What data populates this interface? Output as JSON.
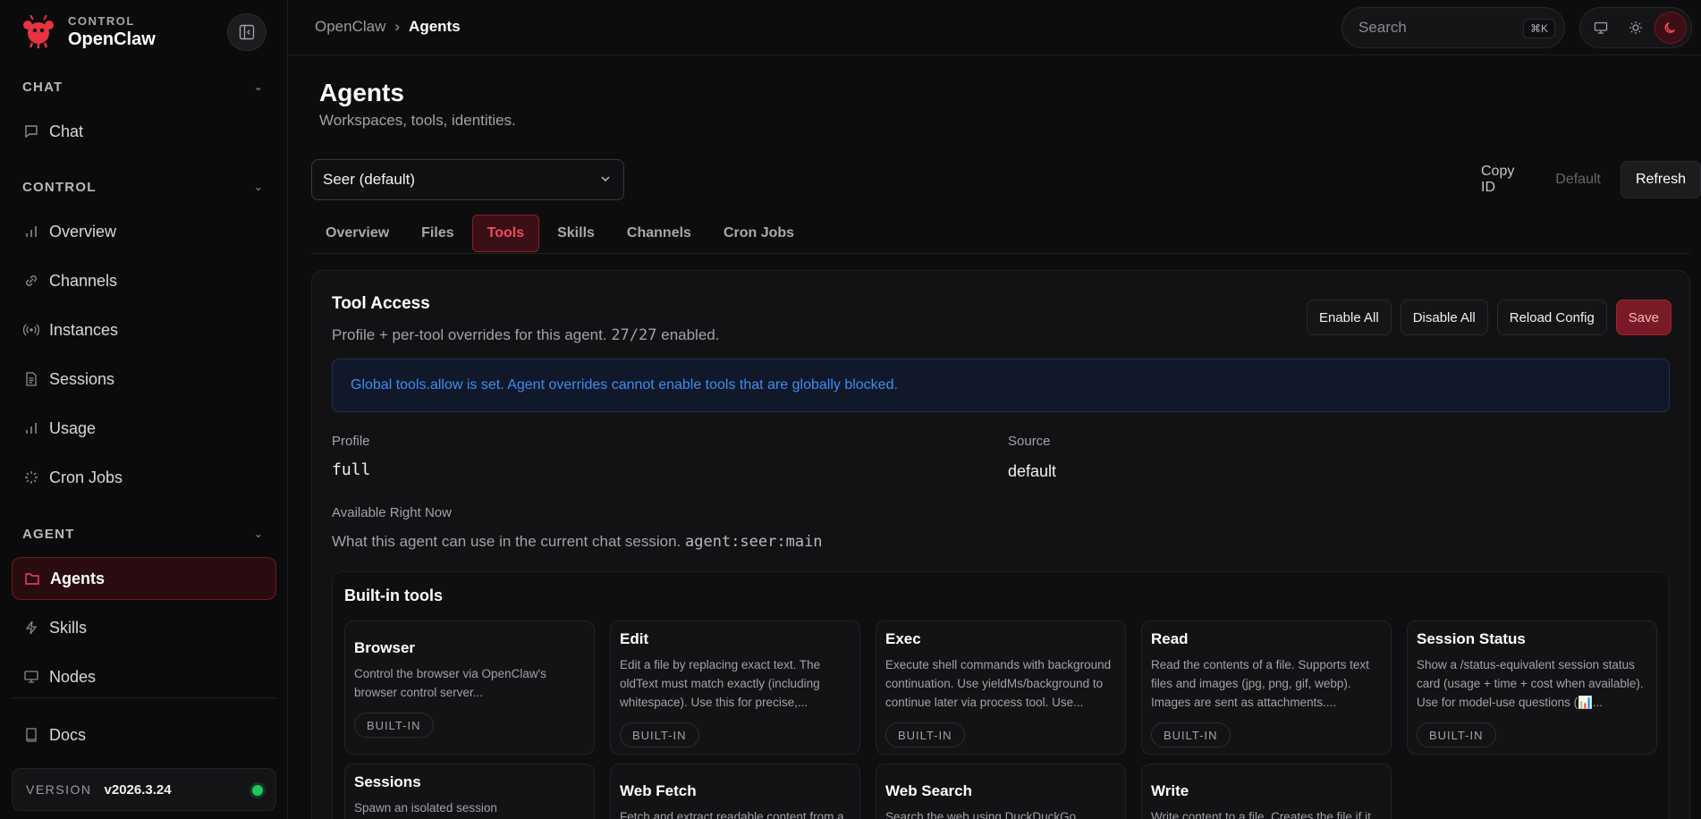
{
  "brand": {
    "eyebrow": "CONTROL",
    "name": "OpenClaw",
    "logo_icon": "lobster-logo-icon"
  },
  "sidebar": {
    "sections": [
      {
        "label": "CHAT",
        "items": [
          {
            "label": "Chat",
            "icon": "chat-bubble-icon"
          }
        ]
      },
      {
        "label": "CONTROL",
        "items": [
          {
            "label": "Overview",
            "icon": "bar-chart-icon"
          },
          {
            "label": "Channels",
            "icon": "link-icon"
          },
          {
            "label": "Instances",
            "icon": "broadcast-icon"
          },
          {
            "label": "Sessions",
            "icon": "document-icon"
          },
          {
            "label": "Usage",
            "icon": "bar-chart-icon"
          },
          {
            "label": "Cron Jobs",
            "icon": "loader-icon"
          }
        ]
      },
      {
        "label": "AGENT",
        "items": [
          {
            "label": "Agents",
            "icon": "folder-icon",
            "active": true
          },
          {
            "label": "Skills",
            "icon": "lightning-icon"
          },
          {
            "label": "Nodes",
            "icon": "monitor-icon"
          }
        ]
      }
    ],
    "docs": {
      "label": "Docs",
      "icon": "book-icon"
    },
    "version": {
      "label": "VERSION",
      "value": "v2026.3.24",
      "status_color": "#22c55e"
    }
  },
  "topbar": {
    "breadcrumb": {
      "root": "OpenClaw",
      "separator": "›",
      "current": "Agents"
    },
    "search": {
      "placeholder": "Search",
      "shortcut": "⌘K"
    }
  },
  "page": {
    "title": "Agents",
    "subtitle": "Workspaces, tools, identities."
  },
  "agent_select": {
    "value": "Seer (default)"
  },
  "actions": {
    "copy_id": "Copy ID",
    "default": "Default",
    "refresh": "Refresh"
  },
  "tabs": [
    "Overview",
    "Files",
    "Tools",
    "Skills",
    "Channels",
    "Cron Jobs"
  ],
  "active_tab": "Tools",
  "tool_access": {
    "title": "Tool Access",
    "desc_prefix": "Profile + per-tool overrides for this agent.",
    "count": "27/27",
    "desc_suffix": "enabled.",
    "buttons": {
      "enable_all": "Enable All",
      "disable_all": "Disable All",
      "reload_config": "Reload Config",
      "save": "Save"
    },
    "notice": "Global tools.allow is set. Agent overrides cannot enable tools that are globally blocked.",
    "profile_label": "Profile",
    "profile_value": "full",
    "source_label": "Source",
    "source_value": "default",
    "available_label": "Available Right Now",
    "available_desc": "What this agent can use in the current chat session.",
    "session_key": "agent:seer:main"
  },
  "builtin": {
    "title": "Built-in tools",
    "tag": "BUILT-IN",
    "tools": [
      {
        "name": "Browser",
        "desc": "Control the browser via OpenClaw's browser control server..."
      },
      {
        "name": "Edit",
        "desc": "Edit a file by replacing exact text. The oldText must match exactly (including whitespace). Use this for precise,..."
      },
      {
        "name": "Exec",
        "desc": "Execute shell commands with background continuation. Use yieldMs/background to continue later via process tool. Use..."
      },
      {
        "name": "Read",
        "desc": "Read the contents of a file. Supports text files and images (jpg, png, gif, webp). Images are sent as attachments...."
      },
      {
        "name": "Session Status",
        "desc": "Show a /status-equivalent session status card (usage + time + cost when available). Use for model-use questions (📊..."
      },
      {
        "name": "Sessions",
        "desc": "Spawn an isolated session"
      },
      {
        "name": "Web Fetch",
        "desc": "Fetch and extract readable content from a"
      },
      {
        "name": "Web Search",
        "desc": "Search the web using DuckDuckGo."
      },
      {
        "name": "Write",
        "desc": "Write content to a file. Creates the file if it"
      }
    ]
  },
  "colors": {
    "accent": "#ef4a5f",
    "accent_bg": "#3a0f15",
    "info": "#3f8cf0"
  }
}
